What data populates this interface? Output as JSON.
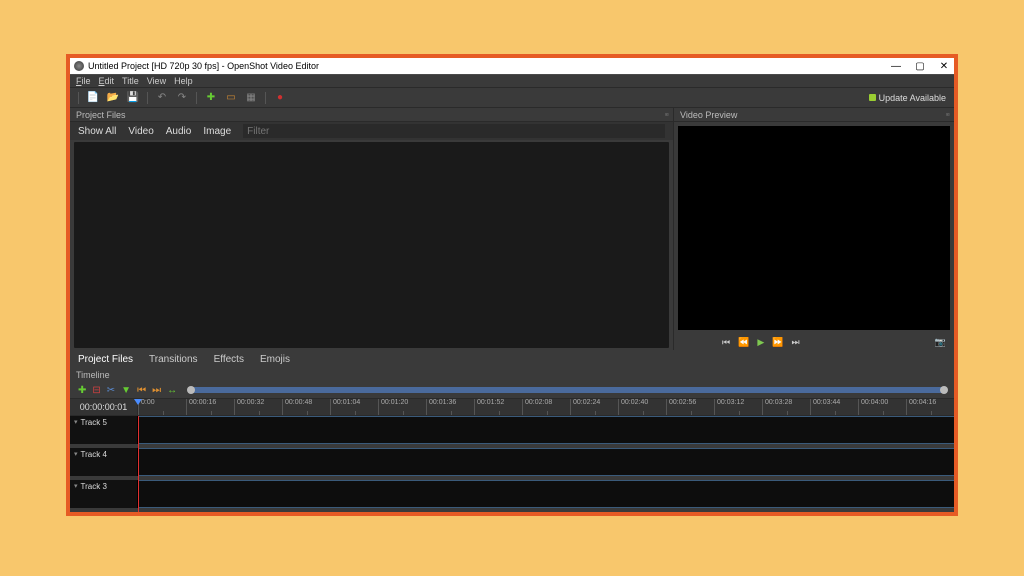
{
  "window": {
    "title": "Untitled Project [HD 720p 30 fps] - OpenShot Video Editor"
  },
  "menubar": {
    "file": "File",
    "edit": "Edit",
    "title": "Title",
    "view": "View",
    "help": "Help"
  },
  "toolbar": {
    "update": "Update Available"
  },
  "panels": {
    "project_files": "Project Files",
    "video_preview": "Video Preview"
  },
  "filter": {
    "show_all": "Show All",
    "video": "Video",
    "audio": "Audio",
    "image": "Image",
    "placeholder": "Filter"
  },
  "bottom_tabs": {
    "project_files": "Project Files",
    "transitions": "Transitions",
    "effects": "Effects",
    "emojis": "Emojis"
  },
  "timeline": {
    "header": "Timeline",
    "timecode": "00:00:00:01",
    "ticks": [
      "0:00",
      "00:00:16",
      "00:00:32",
      "00:00:48",
      "00:01:04",
      "00:01:20",
      "00:01:36",
      "00:01:52",
      "00:02:08",
      "00:02:24",
      "00:02:40",
      "00:02:56",
      "00:03:12",
      "00:03:28",
      "00:03:44",
      "00:04:00",
      "00:04:16"
    ],
    "tracks": [
      "Track 5",
      "Track 4",
      "Track 3"
    ]
  }
}
